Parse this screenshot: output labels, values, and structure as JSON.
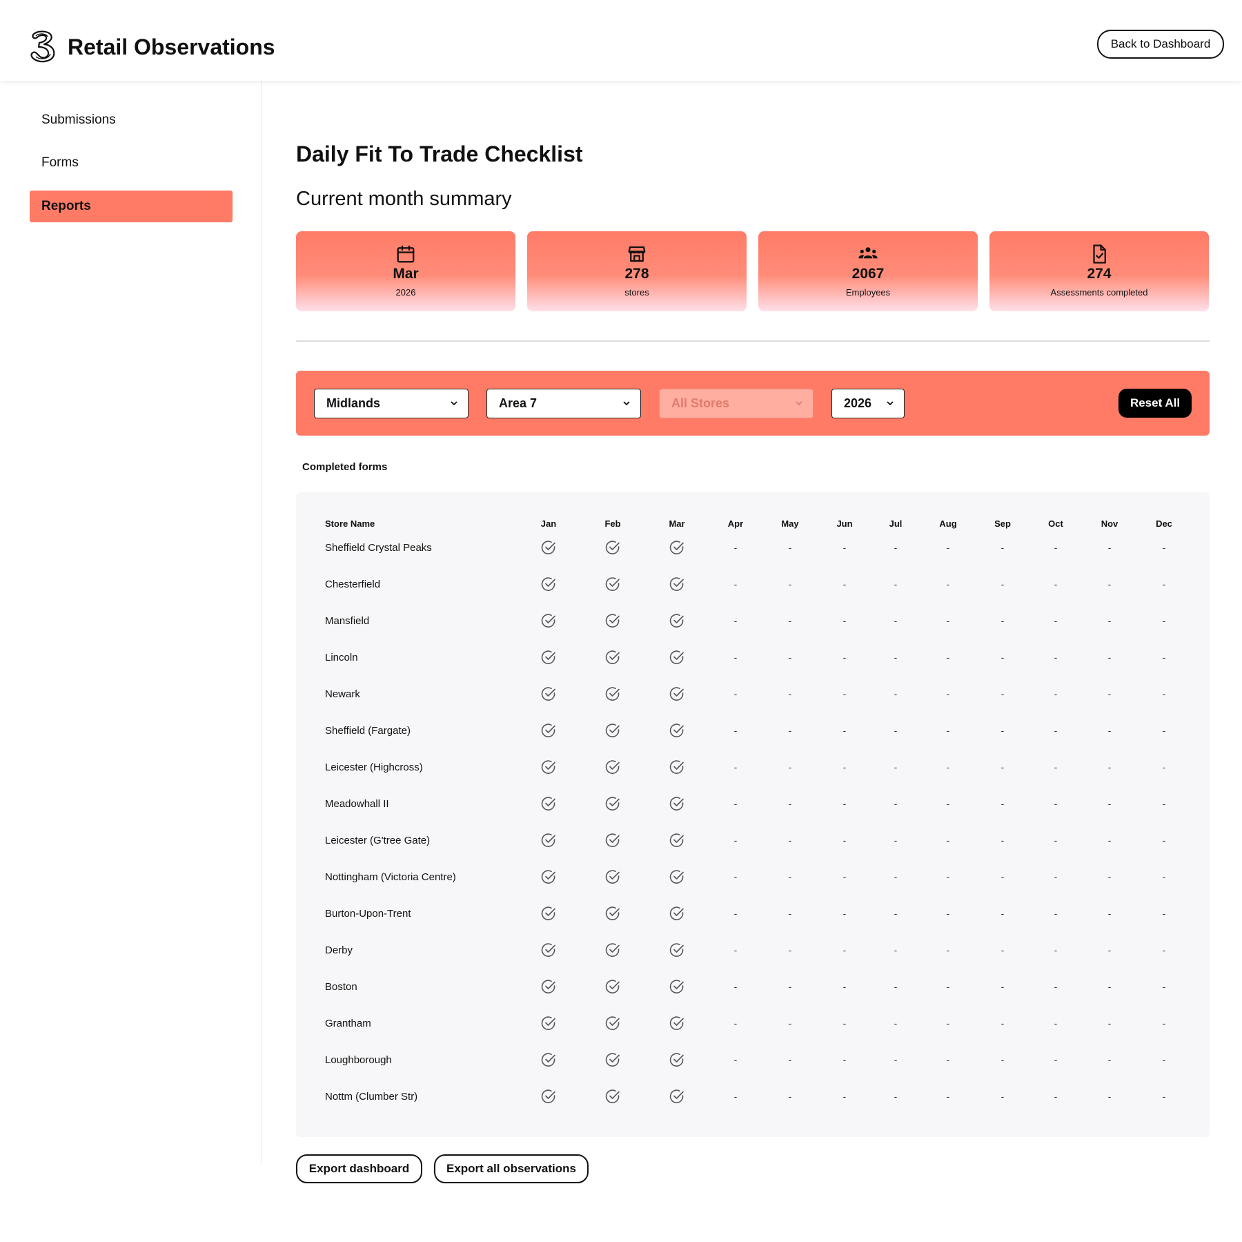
{
  "header": {
    "app_title": "Retail Observations",
    "back_label": "Back to Dashboard",
    "logo_icon": "three-logo-icon"
  },
  "sidebar": {
    "items": [
      {
        "label": "Submissions",
        "active": false
      },
      {
        "label": "Forms",
        "active": false
      },
      {
        "label": "Reports",
        "active": true
      }
    ]
  },
  "main": {
    "title": "Daily Fit To Trade Checklist",
    "summary_title": "Current month summary",
    "cards": [
      {
        "icon": "calendar-icon",
        "value": "Mar",
        "label": "2026"
      },
      {
        "icon": "store-icon",
        "value": "278",
        "label": "stores"
      },
      {
        "icon": "users-icon",
        "value": "2067",
        "label": "Employees"
      },
      {
        "icon": "file-check-icon",
        "value": "274",
        "label": "Assessments completed"
      }
    ]
  },
  "filters": {
    "region": "Midlands",
    "area": "Area 7",
    "store": "All Stores",
    "year": "2026",
    "reset_label": "Reset All"
  },
  "table": {
    "caption": "Completed forms",
    "store_header": "Store Name",
    "months": [
      "Jan",
      "Feb",
      "Mar",
      "Apr",
      "May",
      "Jun",
      "Jul",
      "Aug",
      "Sep",
      "Oct",
      "Nov",
      "Dec"
    ],
    "empty_mark": "-",
    "completed_icon": "check-circle-icon",
    "rows": [
      {
        "store": "Sheffield Crystal Peaks",
        "completed": [
          true,
          true,
          true,
          false,
          false,
          false,
          false,
          false,
          false,
          false,
          false,
          false
        ]
      },
      {
        "store": "Chesterfield",
        "completed": [
          true,
          true,
          true,
          false,
          false,
          false,
          false,
          false,
          false,
          false,
          false,
          false
        ]
      },
      {
        "store": "Mansfield",
        "completed": [
          true,
          true,
          true,
          false,
          false,
          false,
          false,
          false,
          false,
          false,
          false,
          false
        ]
      },
      {
        "store": "Lincoln",
        "completed": [
          true,
          true,
          true,
          false,
          false,
          false,
          false,
          false,
          false,
          false,
          false,
          false
        ]
      },
      {
        "store": "Newark",
        "completed": [
          true,
          true,
          true,
          false,
          false,
          false,
          false,
          false,
          false,
          false,
          false,
          false
        ]
      },
      {
        "store": "Sheffield (Fargate)",
        "completed": [
          true,
          true,
          true,
          false,
          false,
          false,
          false,
          false,
          false,
          false,
          false,
          false
        ]
      },
      {
        "store": "Leicester (Highcross)",
        "completed": [
          true,
          true,
          true,
          false,
          false,
          false,
          false,
          false,
          false,
          false,
          false,
          false
        ]
      },
      {
        "store": "Meadowhall II",
        "completed": [
          true,
          true,
          true,
          false,
          false,
          false,
          false,
          false,
          false,
          false,
          false,
          false
        ]
      },
      {
        "store": "Leicester (G'tree Gate)",
        "completed": [
          true,
          true,
          true,
          false,
          false,
          false,
          false,
          false,
          false,
          false,
          false,
          false
        ]
      },
      {
        "store": "Nottingham (Victoria Centre)",
        "completed": [
          true,
          true,
          true,
          false,
          false,
          false,
          false,
          false,
          false,
          false,
          false,
          false
        ]
      },
      {
        "store": "Burton-Upon-Trent",
        "completed": [
          true,
          true,
          true,
          false,
          false,
          false,
          false,
          false,
          false,
          false,
          false,
          false
        ]
      },
      {
        "store": "Derby",
        "completed": [
          true,
          true,
          true,
          false,
          false,
          false,
          false,
          false,
          false,
          false,
          false,
          false
        ]
      },
      {
        "store": "Boston",
        "completed": [
          true,
          true,
          true,
          false,
          false,
          false,
          false,
          false,
          false,
          false,
          false,
          false
        ]
      },
      {
        "store": "Grantham",
        "completed": [
          true,
          true,
          true,
          false,
          false,
          false,
          false,
          false,
          false,
          false,
          false,
          false
        ]
      },
      {
        "store": "Loughborough",
        "completed": [
          true,
          true,
          true,
          false,
          false,
          false,
          false,
          false,
          false,
          false,
          false,
          false
        ]
      },
      {
        "store": "Nottm (Clumber Str)",
        "completed": [
          true,
          true,
          true,
          false,
          false,
          false,
          false,
          false,
          false,
          false,
          false,
          false
        ]
      }
    ]
  },
  "footer": {
    "export_dashboard_label": "Export dashboard",
    "export_all_label": "Export all observations"
  },
  "colors": {
    "accent": "#ff7b66",
    "panel": "#f7f7f9",
    "disabled_select": "#ffae9f"
  }
}
